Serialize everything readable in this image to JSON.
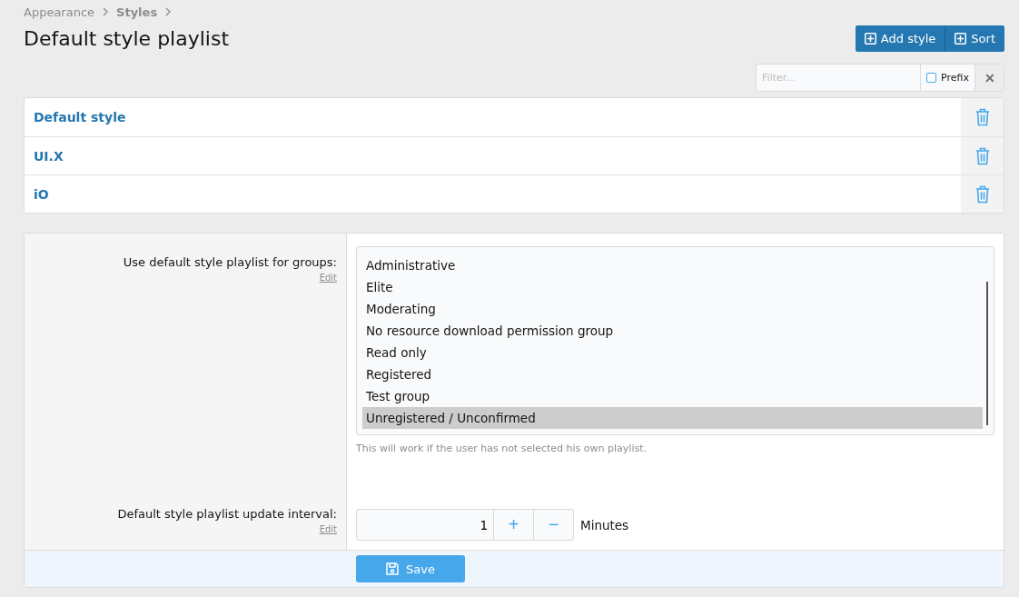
{
  "breadcrumbs": [
    {
      "label": "Appearance",
      "current": false
    },
    {
      "label": "Styles",
      "current": true
    }
  ],
  "title": "Default style playlist",
  "buttons": [
    "Add style",
    "Sort"
  ],
  "filter": {
    "placeholder": "Filter...",
    "prefix_label": "Prefix",
    "prefix_checked": false,
    "clear": "✕"
  },
  "styles": [
    {
      "name": "Default style"
    },
    {
      "name": "UI.X"
    },
    {
      "name": "iO"
    }
  ],
  "options": [
    {
      "kind": "listbox",
      "label": "Use default style playlist for groups:",
      "edit": "Edit",
      "items": [
        {
          "label": "Administrative",
          "selected": false
        },
        {
          "label": "Elite",
          "selected": false
        },
        {
          "label": "Moderating",
          "selected": false
        },
        {
          "label": "No resource download permission group",
          "selected": false
        },
        {
          "label": "Read only",
          "selected": false
        },
        {
          "label": "Registered",
          "selected": false
        },
        {
          "label": "Test group",
          "selected": false
        },
        {
          "label": "Unregistered / Unconfirmed",
          "selected": true
        }
      ],
      "hint": "This will work if the user has not selected his own playlist."
    },
    {
      "kind": "spinner",
      "label": "Default style playlist update interval:",
      "edit": "Edit",
      "value": "1",
      "increment": "+",
      "decrement": "−",
      "unit": "Minutes"
    }
  ],
  "save": "Save"
}
